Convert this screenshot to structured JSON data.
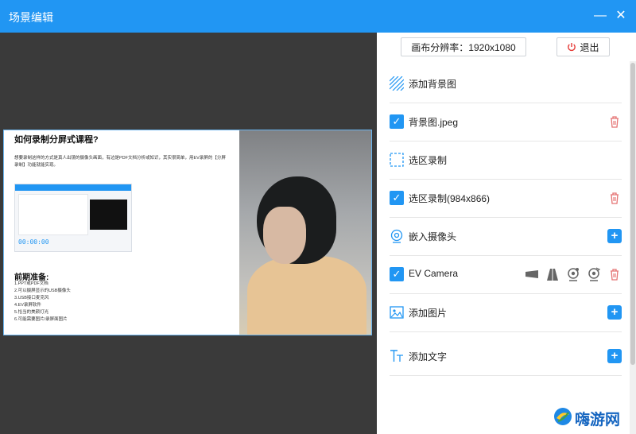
{
  "window": {
    "title": "场景编辑",
    "minimize_icon": "minimize-icon",
    "close_icon": "close-icon",
    "minimize_glyph": "—",
    "close_glyph": "✕"
  },
  "preview": {
    "doc_title": "如何录制分屏式课程?",
    "doc_para": "想要录制这样的方式是真人出镜的摄像头画面，有边是PDF文档分析或知识，其实很简单，用EV录屏的【分屏录制】功能就能实现。",
    "mini_timer": "00:00:00",
    "prep_title": "前期准备:",
    "prep_items": [
      "1.PPT或PDF文档",
      "2.可以摄屏显示的USB摄像头",
      "3.USB接口麦克风",
      "4.EV录屏软件",
      "5.恰当的美颜灯光",
      "6.可能需要图片/录屏面图片"
    ]
  },
  "panel": {
    "resolution_button": "画布分辨率：1920x1080",
    "exit_button": "退出",
    "rows": [
      {
        "label": "添加背景图",
        "icon": "background-hatch-icon"
      },
      {
        "label": "背景图.jpeg",
        "checked": true,
        "icon": "checkbox-checked-icon"
      },
      {
        "label": "选区录制",
        "icon": "dashed-region-icon"
      },
      {
        "label": "选区录制(984x866)",
        "checked": true,
        "icon": "checkbox-checked-icon"
      },
      {
        "label": "嵌入摄像头",
        "icon": "camera-icon"
      },
      {
        "label": "EV Camera",
        "checked": true,
        "icon": "checkbox-checked-icon"
      },
      {
        "label": "添加图片",
        "icon": "image-icon"
      },
      {
        "label": "添加文字",
        "icon": "text-icon"
      }
    ],
    "plus_glyph": "+",
    "check_glyph": "✓"
  },
  "watermark": {
    "text": "嗨游网"
  },
  "colors": {
    "accent": "#2196f3",
    "danger": "#e57373",
    "preview_bg": "#3a3a3a"
  }
}
